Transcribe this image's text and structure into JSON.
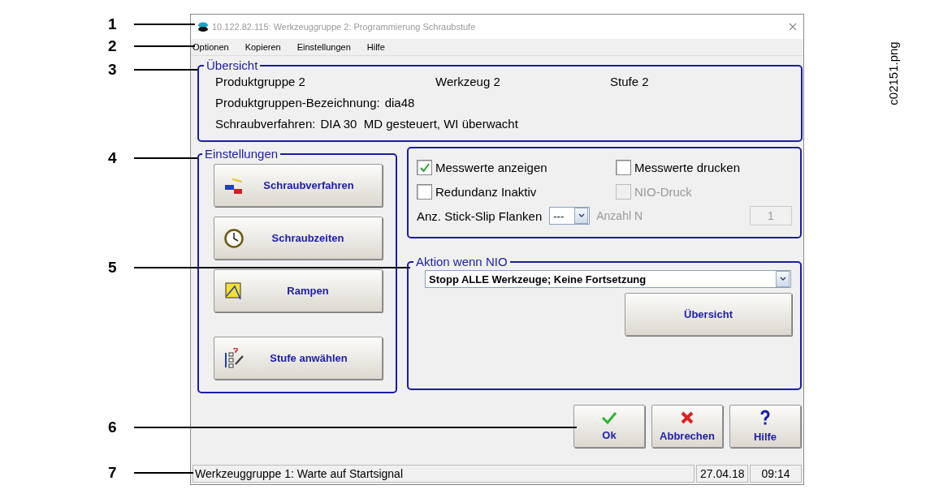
{
  "figure": {
    "callouts": [
      "1",
      "2",
      "3",
      "4",
      "5",
      "6",
      "7"
    ],
    "file_name": "c02151.png"
  },
  "window": {
    "title": "10.122.82.115: Werkzeuggruppe 2: Programmierung Schraubstufe"
  },
  "menu": [
    "Optionen",
    "Kopieren",
    "Einstellungen",
    "Hilfe"
  ],
  "overview": {
    "legend": "Übersicht",
    "product_group": "Produktgruppe 2",
    "tool": "Werkzeug 2",
    "stage": "Stufe 2",
    "designation_label": "Produktgruppen-Bezeichnung:",
    "designation": "dia48",
    "method_label": "Schraubverfahren:",
    "method": "DIA 30  MD gesteuert, WI überwacht"
  },
  "settings": {
    "legend": "Einstellungen",
    "buttons": [
      {
        "label": "Schraubverfahren",
        "kind": "method"
      },
      {
        "label": "Schraubzeiten",
        "kind": "times"
      },
      {
        "label": "Rampen",
        "kind": "ramps"
      },
      {
        "label": "Stufe anwählen",
        "kind": "stage"
      }
    ]
  },
  "options": {
    "checkboxes": [
      {
        "label": "Messwerte anzeigen",
        "checked": true,
        "disabled": false
      },
      {
        "label": "Messwerte drucken",
        "checked": false,
        "disabled": false
      },
      {
        "label": "Redundanz Inaktiv",
        "checked": false,
        "disabled": false
      },
      {
        "label": "NIO-Druck",
        "checked": false,
        "disabled": true
      }
    ],
    "stick_slip": {
      "label": "Anz. Stick-Slip Flanken",
      "value": "---"
    },
    "count": {
      "label": "Anzahl N",
      "value": "1",
      "disabled": true
    }
  },
  "action": {
    "legend": "Aktion wenn NIO",
    "value": "Stopp ALLE Werkzeuge; Keine Fortsetzung",
    "button": "Übersicht"
  },
  "dialog_buttons": [
    {
      "label": "Ok",
      "kind": "ok"
    },
    {
      "label": "Abbrechen",
      "kind": "cancel"
    },
    {
      "label": "Hilfe",
      "kind": "help"
    }
  ],
  "status": {
    "message": "Werkzeuggruppe 1: Warte auf Startsignal",
    "date": "27.04.18",
    "time": "09:14"
  }
}
